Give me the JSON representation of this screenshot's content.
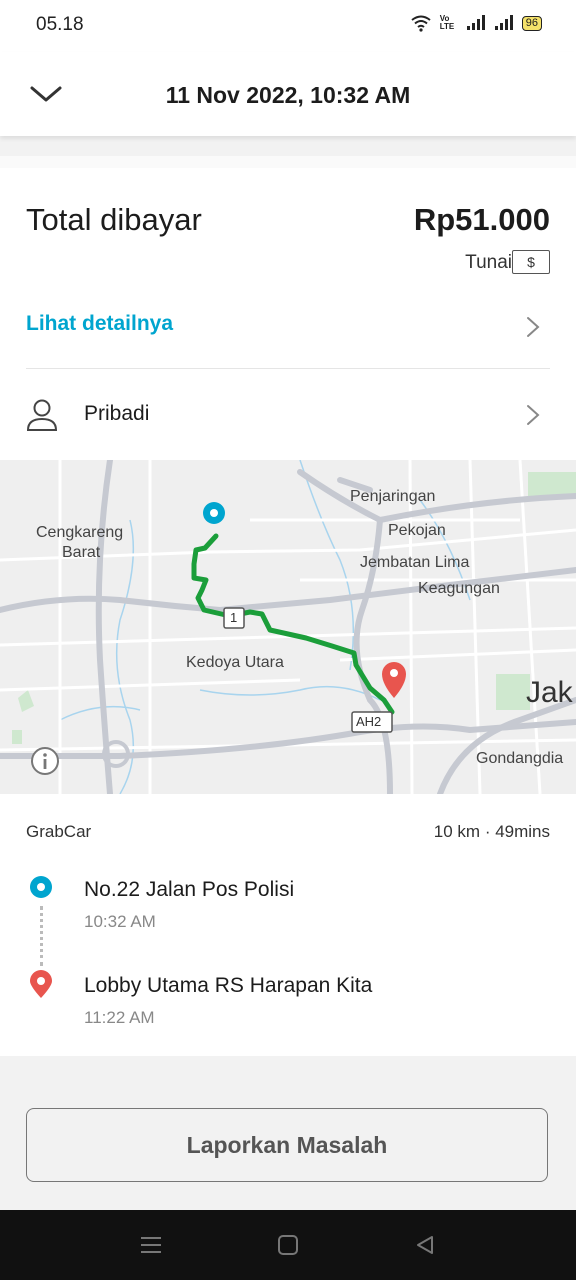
{
  "status_bar": {
    "time": "05.18",
    "network": "Vo LTE",
    "battery": "96"
  },
  "header": {
    "title": "11 Nov 2022, 10:32 AM",
    "collapse_icon": "chevron-down-icon"
  },
  "payment": {
    "total_label": "Total dibayar",
    "total_amount": "Rp51.000",
    "method": "Tunai",
    "method_icon_symbol": "$",
    "detail_link": "Lihat detailnya",
    "profile_label": "Pribadi"
  },
  "map": {
    "labels": {
      "penjaringan": "Penjaringan",
      "pekojan": "Pekojan",
      "jembatan_lima": "Jembatan Lima",
      "keagungan": "Keagungan",
      "cengkareng_1": "Cengkareng",
      "cengkareng_2": "Barat",
      "kedoya": "Kedoya Utara",
      "jak": "Jak",
      "gondangdia": "Gondangdia",
      "road_1": "1",
      "road_ah": "AH2"
    },
    "route_color": "#1b9e3a",
    "pickup_color": "#00a5cf",
    "dropoff_color": "#e8554e"
  },
  "trip": {
    "service": "GrabCar",
    "stats": "10 km · 49mins",
    "pickup": {
      "name": "No.22 Jalan Pos Polisi",
      "time": "10:32 AM"
    },
    "dropoff": {
      "name": "Lobby Utama RS Harapan Kita",
      "time": "11:22 AM"
    }
  },
  "actions": {
    "report_label": "Laporkan Masalah"
  },
  "colors": {
    "accent": "#00a5cf",
    "route": "#1b9e3a",
    "dropoff": "#e8554e"
  }
}
